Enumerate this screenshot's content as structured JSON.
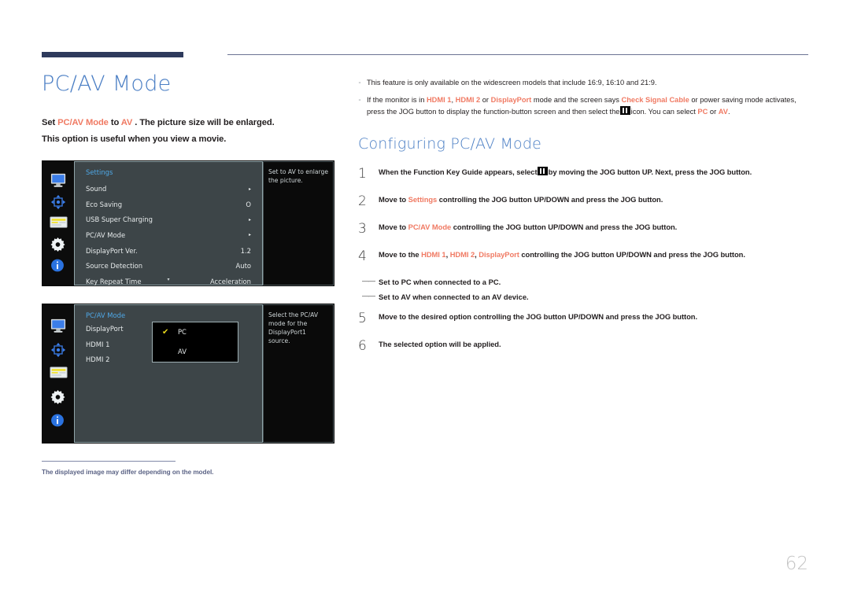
{
  "page_title": "PC/AV Mode",
  "page_number": "62",
  "accent_color": "#f07a63",
  "title_color": "#4a7ec4",
  "intro": {
    "line1_a": "Set ",
    "line1_b": "PC/AV Mode",
    "line1_c": " to ",
    "line1_d": "AV",
    "line1_e": " . The picture size will be enlarged.",
    "line2": "This option is useful when you view a movie."
  },
  "osd_settings": {
    "heading": "Settings",
    "rows": [
      {
        "label": "Sound",
        "value": "▸"
      },
      {
        "label": "Eco Saving",
        "value": "O"
      },
      {
        "label": "USB Super Charging",
        "value": "▸"
      },
      {
        "label": "PC/AV Mode",
        "value": "▸"
      },
      {
        "label": "DisplayPort Ver.",
        "value": "1.2"
      },
      {
        "label": "Source Detection",
        "value": "Auto"
      },
      {
        "label": "Key Repeat Time",
        "value": "Acceleration"
      }
    ],
    "scroll_glyph": "▾",
    "description": "Set to AV to enlarge the picture.",
    "icons": [
      "monitor-icon",
      "directional-pad-icon",
      "onscreen-display-icon",
      "gear-icon",
      "info-icon"
    ]
  },
  "osd_pcav": {
    "heading": "PC/AV Mode",
    "rows": [
      {
        "label": "DisplayPort"
      },
      {
        "label": "HDMI 1"
      },
      {
        "label": "HDMI 2"
      }
    ],
    "dropdown": {
      "options": [
        "PC",
        "AV"
      ],
      "selected": "PC",
      "check_glyph": "✔"
    },
    "description": "Select the PC/AV mode for the DisplayPort1 source.",
    "icons": [
      "monitor-icon",
      "directional-pad-icon",
      "onscreen-display-icon",
      "gear-icon",
      "info-icon"
    ]
  },
  "footnote": "The displayed image may differ depending on the model.",
  "notes": [
    {
      "mark": "⁃",
      "segments": [
        {
          "t": "This feature is only available on the widescreen models that include 16:9, 16:10 and 21:9.",
          "c": "plain"
        }
      ]
    },
    {
      "mark": "⁃",
      "segments": [
        {
          "t": "If the monitor is in ",
          "c": "plain"
        },
        {
          "t": "HDMI 1",
          "c": "accent"
        },
        {
          "t": ", ",
          "c": "plain"
        },
        {
          "t": "HDMI 2",
          "c": "accent"
        },
        {
          "t": " or ",
          "c": "plain"
        },
        {
          "t": "DisplayPort",
          "c": "accent"
        },
        {
          "t": " mode and the screen says ",
          "c": "plain"
        },
        {
          "t": "Check Signal Cable",
          "c": "accent"
        },
        {
          "t": " or power saving mode activates, press the JOG button to display the function-button screen and then select the ",
          "c": "plain"
        },
        {
          "t": "GLYPH",
          "c": "glyph"
        },
        {
          "t": " icon. You can select ",
          "c": "plain"
        },
        {
          "t": "PC",
          "c": "accent"
        },
        {
          "t": " or ",
          "c": "plain"
        },
        {
          "t": "AV",
          "c": "accent"
        },
        {
          "t": ".",
          "c": "plain"
        }
      ]
    }
  ],
  "section_heading": "Configuring PC/AV Mode",
  "steps": [
    {
      "num": "1",
      "segments": [
        {
          "t": "When the Function Key Guide appears, select ",
          "c": "plain"
        },
        {
          "t": "GLYPH",
          "c": "glyph"
        },
        {
          "t": " by moving the JOG button UP. Next, press the JOG button.",
          "c": "plain"
        }
      ]
    },
    {
      "num": "2",
      "segments": [
        {
          "t": "Move to ",
          "c": "plain"
        },
        {
          "t": "Settings",
          "c": "accent"
        },
        {
          "t": " controlling the JOG button UP/DOWN and press the JOG button.",
          "c": "plain"
        }
      ]
    },
    {
      "num": "3",
      "segments": [
        {
          "t": "Move to ",
          "c": "plain"
        },
        {
          "t": "PC/AV Mode",
          "c": "accent"
        },
        {
          "t": " controlling the JOG button UP/DOWN and press the JOG button.",
          "c": "plain"
        }
      ]
    },
    {
      "num": "4",
      "segments": [
        {
          "t": "Move to the ",
          "c": "plain"
        },
        {
          "t": "HDMI 1",
          "c": "accent"
        },
        {
          "t": ", ",
          "c": "plain"
        },
        {
          "t": "HDMI 2",
          "c": "accent"
        },
        {
          "t": ", ",
          "c": "plain"
        },
        {
          "t": "DisplayPort",
          "c": "accent"
        },
        {
          "t": " controlling the JOG button UP/DOWN and press the JOG button.",
          "c": "plain"
        }
      ]
    }
  ],
  "sub_notes": [
    {
      "mark": "――",
      "text": "Set to PC when connected to a PC."
    },
    {
      "mark": "――",
      "text": "Set to AV when connected to an AV device."
    }
  ],
  "steps_tail": [
    {
      "num": "5",
      "segments": [
        {
          "t": "Move to the desired option controlling the JOG button UP/DOWN and press the JOG button.",
          "c": "plain"
        }
      ]
    },
    {
      "num": "6",
      "segments": [
        {
          "t": "The selected option will be applied.",
          "c": "plain"
        }
      ]
    }
  ]
}
